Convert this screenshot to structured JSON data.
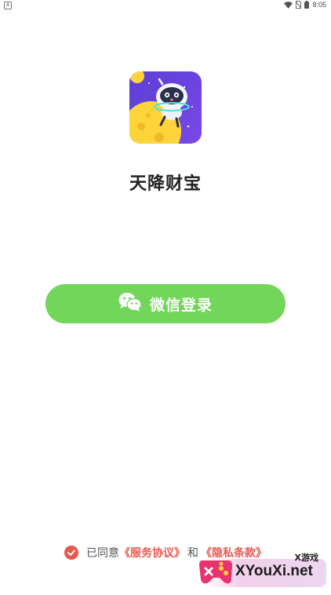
{
  "status_bar": {
    "left_indicator": "A",
    "time": "8:05",
    "icons": [
      "wifi-icon",
      "no-sim-icon",
      "battery-icon"
    ]
  },
  "app": {
    "name": "天降财宝",
    "logo_icon": "astronaut-moon-logo"
  },
  "login": {
    "wechat_label": "微信登录",
    "icon": "wechat-icon",
    "button_color": "#72d65a"
  },
  "agreement": {
    "checked": true,
    "prefix": "已同意",
    "service_link": "《服务协议》",
    "conjunction": "和",
    "privacy_link": "《隐私条款》",
    "link_color": "#e8584d"
  },
  "watermark": {
    "sub": "X游戏",
    "main": "XYouXi.net"
  }
}
